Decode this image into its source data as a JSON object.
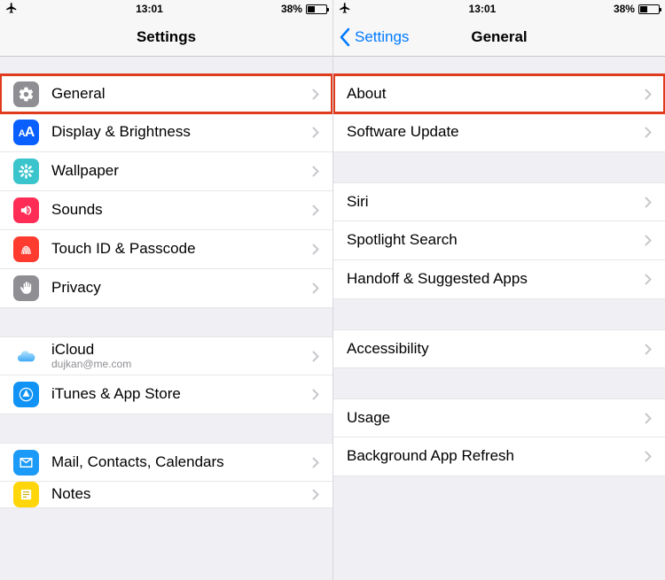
{
  "status": {
    "time": "13:01",
    "battery_text": "38%"
  },
  "left": {
    "nav_title": "Settings",
    "rows": {
      "general": "General",
      "display": "Display & Brightness",
      "wallpaper": "Wallpaper",
      "sounds": "Sounds",
      "touchid": "Touch ID & Passcode",
      "privacy": "Privacy",
      "icloud": "iCloud",
      "icloud_sub": "dujkan@me.com",
      "itunes": "iTunes & App Store",
      "mail": "Mail, Contacts, Calendars",
      "notes": "Notes"
    }
  },
  "right": {
    "nav_back": "Settings",
    "nav_title": "General",
    "rows": {
      "about": "About",
      "software_update": "Software Update",
      "siri": "Siri",
      "spotlight": "Spotlight Search",
      "handoff": "Handoff & Suggested Apps",
      "accessibility": "Accessibility",
      "usage": "Usage",
      "background_refresh": "Background App Refresh"
    }
  }
}
